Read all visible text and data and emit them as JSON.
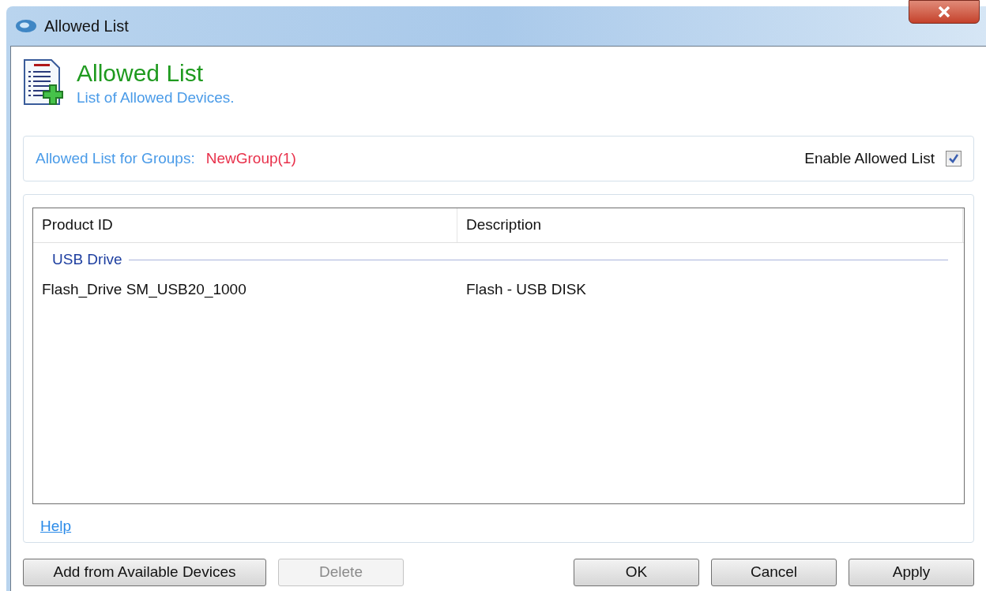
{
  "window": {
    "title": "Allowed List"
  },
  "header": {
    "title": "Allowed List",
    "subtitle": "List of Allowed Devices."
  },
  "groups": {
    "label": "Allowed List for Groups:",
    "value": "NewGroup(1)"
  },
  "enable": {
    "label": "Enable Allowed List",
    "checked": true
  },
  "table": {
    "columns": [
      "Product ID",
      "Description"
    ],
    "groups": [
      {
        "name": "USB Drive",
        "rows": [
          {
            "cells": [
              "Flash_Drive SM_USB20_1000",
              "Flash - USB DISK"
            ]
          }
        ]
      }
    ]
  },
  "help": "Help",
  "buttons_left": [
    {
      "label": "Add from Available Devices",
      "disabled": false
    },
    {
      "label": "Delete",
      "disabled": true
    }
  ],
  "buttons_right": [
    {
      "label": "OK",
      "disabled": false
    },
    {
      "label": "Cancel",
      "disabled": false
    },
    {
      "label": "Apply",
      "disabled": false
    }
  ]
}
